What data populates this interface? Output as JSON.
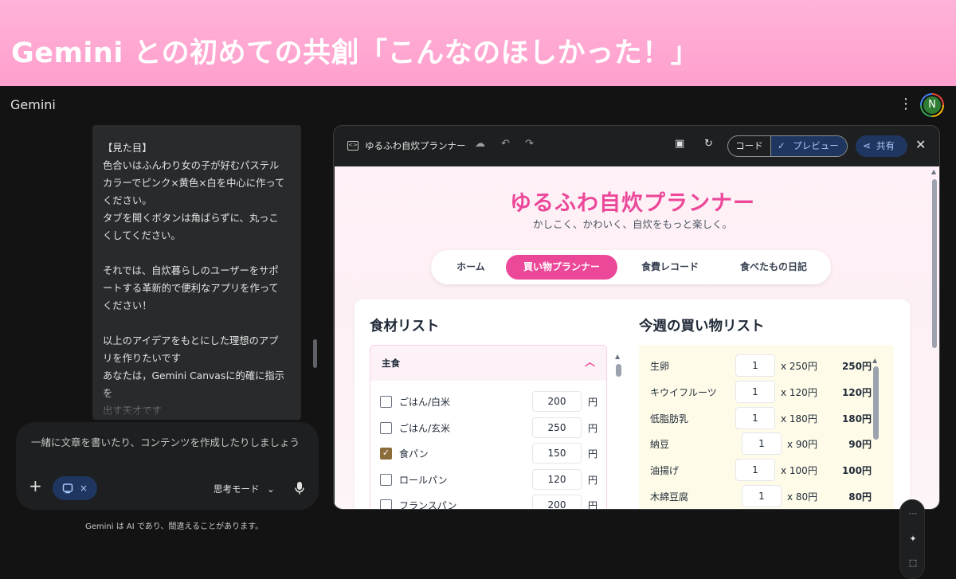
{
  "banner": {
    "title": "Gemini との初めての共創「こんなのほしかった！」"
  },
  "app": {
    "title": "Gemini",
    "avatar_initial": "N"
  },
  "chat": {
    "message": "【見た目】\n色合いはふんわり女の子が好むパステル\nカラーでピンク×黄色×白を中心に作って\nください。\nタブを開くボタンは角ばらずに、丸っこ\nくしてください。\n\nそれでは、自炊暮らしのユーザーをサポ\nートする革新的で便利なアプリを作って\nください！\n\n以上のアイデアをもとにした理想のアプ\nリを作りたいです\nあなたは，Gemini Canvasに的確に指示を\n出す天才です\n私が書いたアイデアに対して"
  },
  "composer": {
    "placeholder": "一緒に文章を書いたり、コンテンツを作成したりしましょう",
    "chip_close": "×",
    "mode": "思考モード",
    "disclaimer": "Gemini は AI であり、間違えることがあります。"
  },
  "canvas": {
    "title": "ゆるふわ自炊プランナー",
    "code_tab": "コード",
    "preview_tab": "プレビュー",
    "share": "共有"
  },
  "preview": {
    "app_title": "ゆるふわ自炊プランナー",
    "subtitle": "かしこく、かわいく、自炊をもっと楽しく。",
    "nav": [
      "ホーム",
      "買い物プランナー",
      "食費レコード",
      "食べたもの日記"
    ],
    "ingredients_heading": "食材リスト",
    "category": "主食",
    "yen": "円",
    "ingredients": [
      {
        "name": "ごはん/白米",
        "price": "200",
        "checked": false
      },
      {
        "name": "ごはん/玄米",
        "price": "250",
        "checked": false
      },
      {
        "name": "食パン",
        "price": "150",
        "checked": true
      },
      {
        "name": "ロールパン",
        "price": "120",
        "checked": false
      },
      {
        "name": "フランスパン",
        "price": "200",
        "checked": false
      }
    ],
    "shopping_heading": "今週の買い物リスト",
    "shopping": [
      {
        "name": "生卵",
        "qty": "1",
        "unit": "x 250円",
        "total": "250円"
      },
      {
        "name": "キウイフルーツ",
        "qty": "1",
        "unit": "x 120円",
        "total": "120円"
      },
      {
        "name": "低脂肪乳",
        "qty": "1",
        "unit": "x 180円",
        "total": "180円"
      },
      {
        "name": "納豆",
        "qty": "1",
        "unit": "x 90円",
        "total": "90円"
      },
      {
        "name": "油揚げ",
        "qty": "1",
        "unit": "x 100円",
        "total": "100円"
      },
      {
        "name": "木綿豆腐",
        "qty": "1",
        "unit": "x 80円",
        "total": "80円"
      }
    ]
  },
  "colors": {
    "accent_pink": "#ec4899",
    "banner_pink": "#ff9fcd",
    "shop_bg": "#fefce8"
  }
}
